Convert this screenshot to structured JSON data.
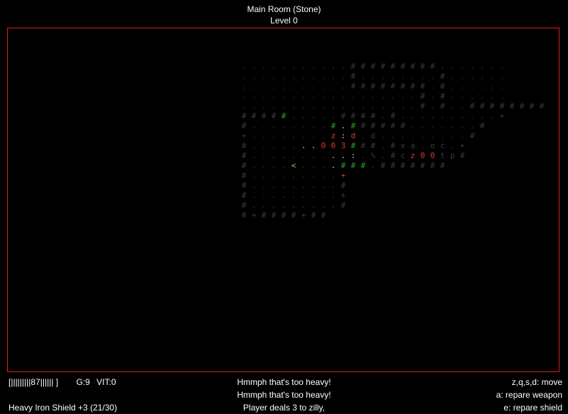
{
  "header": {
    "room": "Main Room (Stone)",
    "level": "Level 0"
  },
  "status": {
    "health_bar": "[|||||||||87||||||   ]",
    "gold": "G:9",
    "vitality": "VIT:0",
    "equipment": "Heavy Iron Shield +3 (21/30)"
  },
  "log": [
    "Hmmph that's too heavy!",
    "Hmmph that's too heavy!",
    "Player deals 3 to zilly,"
  ],
  "controls": [
    "z,q,s,d: move",
    "a: repare weapon",
    "e:  repare shield"
  ],
  "palette": {
    "wall_dim": "#3a3a3a",
    "floor_dim": "#333333",
    "wall_lit": "#2aa52a",
    "floor_lit": "#cccccc",
    "enemy": "#e03a2a",
    "stairs": "#e0b020",
    "border": "#d42020",
    "text": "#ffffff"
  },
  "map": {
    "rows": [
      "...........#########.......",
      "...........#........#......",
      "...........########.#......",
      "..................#.#......",
      "..................#.#..########",
      "#####.....####.#..........+",
      "#........#.######.......#",
      "+........Z:D.d.........#",
      "#.......003###.#XA.OC.+",
      "#..........:.%.#CZ00TP#",
      "#....<....###.#######",
      "#.........+",
      "#.........#",
      "#.........+",
      "#.........#",
      "#+####+##"
    ]
  }
}
